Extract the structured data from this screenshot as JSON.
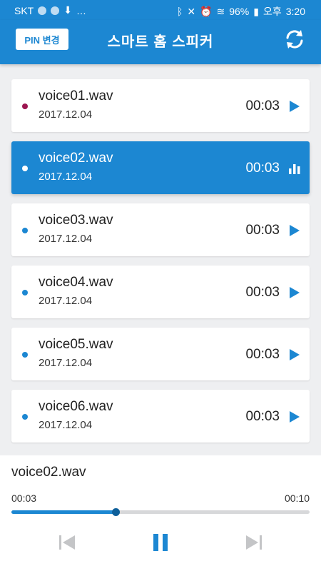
{
  "status_bar": {
    "carrier": "SKT",
    "battery": "96%",
    "ampm": "오후",
    "time": "3:20"
  },
  "header": {
    "pin_button_label": "PIN 변경",
    "title": "스마트 홈 스피커",
    "refresh_icon": "refresh-icon"
  },
  "recordings": [
    {
      "name": "voice01.wav",
      "date": "2017.12.04",
      "duration": "00:03",
      "state": "played",
      "icon": "play-icon"
    },
    {
      "name": "voice02.wav",
      "date": "2017.12.04",
      "duration": "00:03",
      "state": "playing",
      "icon": "equalizer-icon"
    },
    {
      "name": "voice03.wav",
      "date": "2017.12.04",
      "duration": "00:03",
      "state": "unplayed",
      "icon": "play-icon"
    },
    {
      "name": "voice04.wav",
      "date": "2017.12.04",
      "duration": "00:03",
      "state": "unplayed",
      "icon": "play-icon"
    },
    {
      "name": "voice05.wav",
      "date": "2017.12.04",
      "duration": "00:03",
      "state": "unplayed",
      "icon": "play-icon"
    },
    {
      "name": "voice06.wav",
      "date": "2017.12.04",
      "duration": "00:03",
      "state": "unplayed",
      "icon": "play-icon"
    }
  ],
  "player": {
    "title": "voice02.wav",
    "current_time": "00:03",
    "total_time": "00:10",
    "progress_fraction": 0.35,
    "controls": [
      "skip-previous-icon",
      "pause-icon",
      "skip-next-icon"
    ]
  },
  "colors": {
    "accent": "#1c87d2",
    "played_dot": "#9c1550",
    "background": "#eeeff1"
  }
}
